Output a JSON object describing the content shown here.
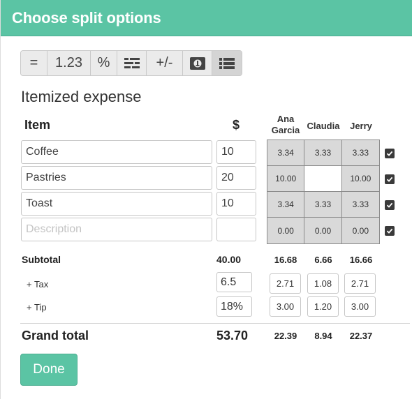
{
  "dialog": {
    "title": "Choose split options"
  },
  "toolbar": {
    "buttons": [
      {
        "label": "=",
        "icon": "equals-icon"
      },
      {
        "label": "1.23",
        "icon": ""
      },
      {
        "label": "%",
        "icon": ""
      },
      {
        "label": "",
        "icon": "shares-icon"
      },
      {
        "label": "+/-",
        "icon": ""
      },
      {
        "label": "",
        "icon": "receipt-icon"
      },
      {
        "label": "",
        "icon": "itemized-list-icon",
        "active": true
      }
    ]
  },
  "section": {
    "title": "Itemized expense"
  },
  "columns": {
    "item": "Item",
    "amount": "$",
    "people": [
      {
        "line1": "Ana",
        "line2": "Garcia"
      },
      {
        "line1": "Claudia",
        "line2": ""
      },
      {
        "line1": "Jerry",
        "line2": ""
      }
    ]
  },
  "items": [
    {
      "name": "Coffee",
      "amount": "10",
      "shares": [
        "3.34",
        "3.33",
        "3.33"
      ],
      "checked": true
    },
    {
      "name": "Pastries",
      "amount": "20",
      "shares": [
        "10.00",
        "",
        "10.00"
      ],
      "checked": true
    },
    {
      "name": "Toast",
      "amount": "10",
      "shares": [
        "3.34",
        "3.33",
        "3.33"
      ],
      "checked": true
    },
    {
      "name": "",
      "placeholder": "Description",
      "amount": "",
      "shares": [
        "0.00",
        "0.00",
        "0.00"
      ],
      "checked": true
    }
  ],
  "subtotal": {
    "label": "Subtotal",
    "total": "40.00",
    "people": [
      "16.68",
      "6.66",
      "16.66"
    ]
  },
  "tax": {
    "label": "+ Tax",
    "rate": "6.5",
    "people": [
      "2.71",
      "1.08",
      "2.71"
    ]
  },
  "tip": {
    "label": "+ Tip",
    "rate": "18%",
    "people": [
      "3.00",
      "1.20",
      "3.00"
    ]
  },
  "grand_total": {
    "label": "Grand total",
    "total": "53.70",
    "people": [
      "22.39",
      "8.94",
      "22.37"
    ]
  },
  "done_button": {
    "label": "Done"
  },
  "colors": {
    "accent": "#5bc4a4",
    "cell_bg": "#d9d9d9"
  }
}
